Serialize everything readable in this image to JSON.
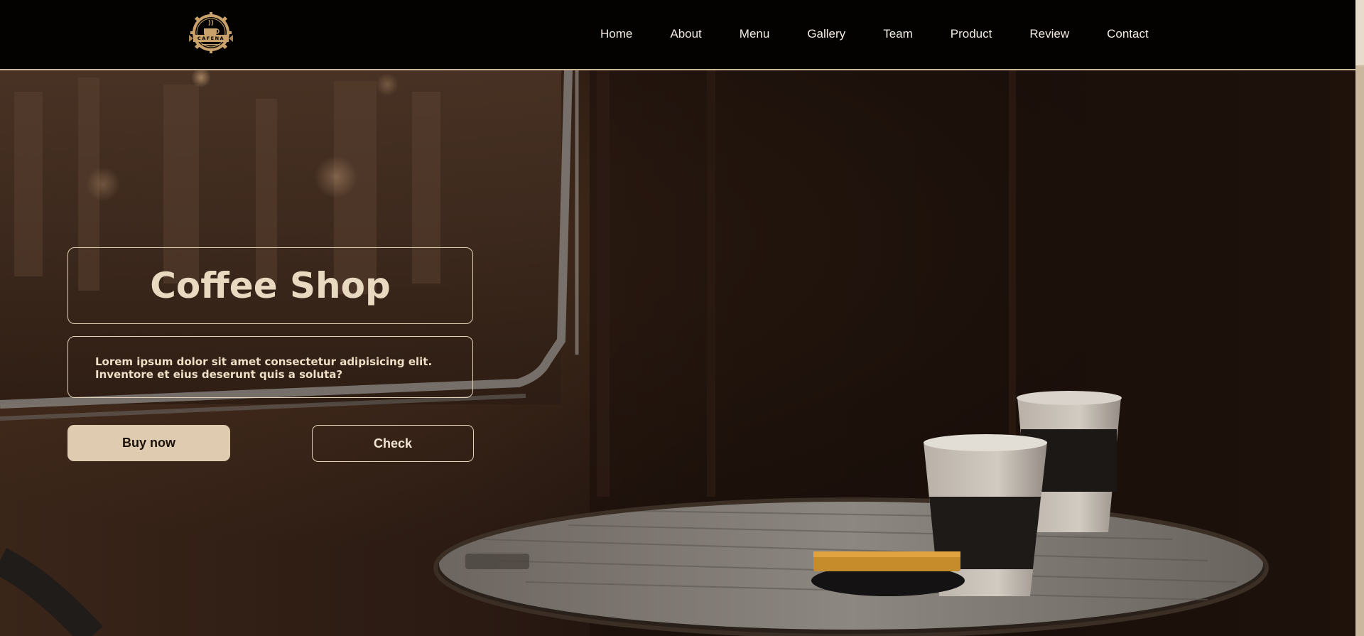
{
  "brand": {
    "logo_text": "CAFENA",
    "accent": "#dfccb0",
    "border": "#e3d2b8",
    "nav_text_color": "#f2ebe2"
  },
  "nav": {
    "items": [
      {
        "label": "Home"
      },
      {
        "label": "About"
      },
      {
        "label": "Menu"
      },
      {
        "label": "Gallery"
      },
      {
        "label": "Team"
      },
      {
        "label": "Product"
      },
      {
        "label": "Review"
      },
      {
        "label": "Contact"
      }
    ]
  },
  "hero": {
    "title": "Coffee Shop",
    "description": "Lorem ipsum dolor sit amet consectetur adipisicing elit. Inventore et eius deserunt quis a soluta?",
    "buy_label": "Buy now",
    "check_label": "Check",
    "background": "cafe table with two paper coffee cups"
  }
}
